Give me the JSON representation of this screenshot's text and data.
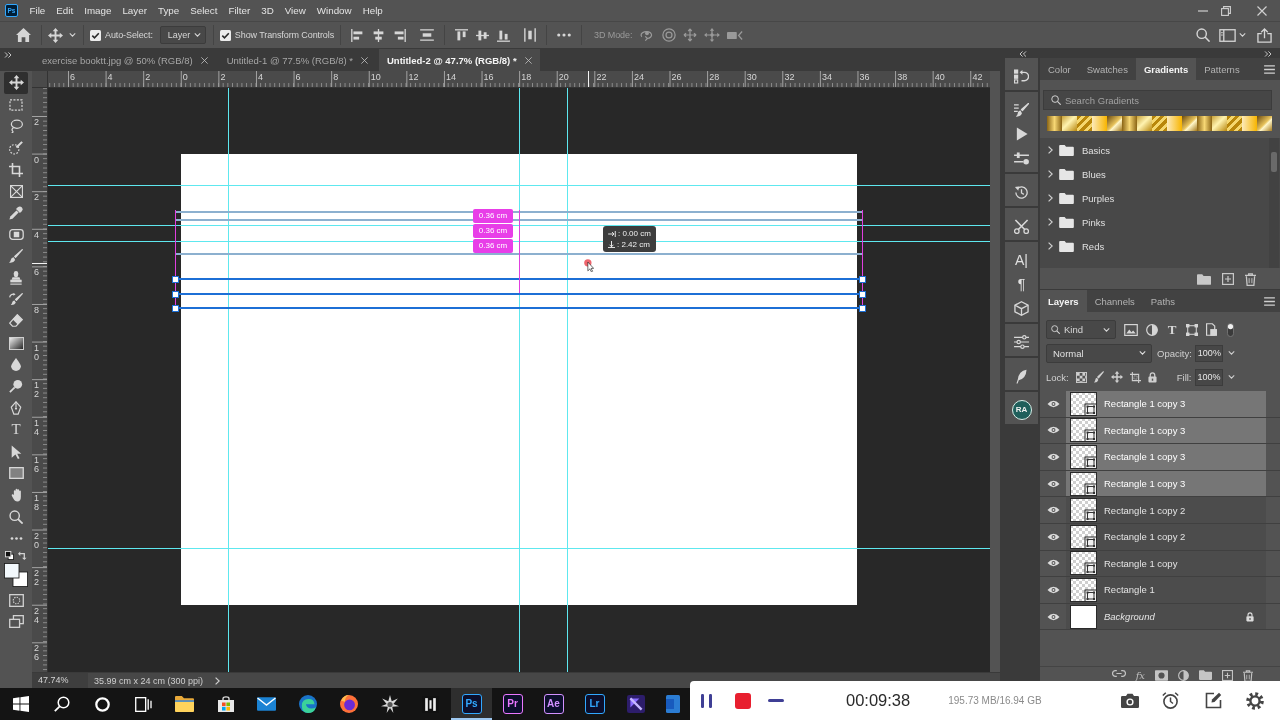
{
  "app_logo": "Ps",
  "menu": [
    "File",
    "Edit",
    "Image",
    "Layer",
    "Type",
    "Select",
    "Filter",
    "3D",
    "View",
    "Window",
    "Help"
  ],
  "options_bar": {
    "auto_select": {
      "label": "Auto-Select:",
      "checked": true
    },
    "auto_select_target": "Layer",
    "show_transform_controls": {
      "label": "Show Transform Controls",
      "checked": true
    },
    "mode_3d": {
      "label": "3D Mode:",
      "disabled": true
    }
  },
  "document_tabs": [
    {
      "title": "exercise booktt.jpg @ 50% (RGB/8)",
      "selected": false
    },
    {
      "title": "Untitled-1 @ 77.5% (RGB/8) *",
      "selected": false
    },
    {
      "title": "Untitled-2 @ 47.7% (RGB/8) *",
      "selected": true
    }
  ],
  "tools": [
    {
      "kind": "move",
      "selected": true
    },
    {
      "kind": "marquee",
      "selected": false
    },
    {
      "kind": "lasso",
      "selected": false
    },
    {
      "kind": "quick_select",
      "selected": false
    },
    {
      "kind": "crop",
      "selected": false
    },
    {
      "kind": "frame",
      "selected": false
    },
    {
      "kind": "eyedropper",
      "selected": false
    },
    {
      "kind": "healing",
      "selected": false
    },
    {
      "kind": "brush",
      "selected": false
    },
    {
      "kind": "stamp",
      "selected": false
    },
    {
      "kind": "history_brush",
      "selected": false
    },
    {
      "kind": "eraser",
      "selected": false
    },
    {
      "kind": "gradient",
      "selected": false
    },
    {
      "kind": "blur",
      "selected": false
    },
    {
      "kind": "dodge",
      "selected": false
    },
    {
      "kind": "pen",
      "selected": false
    },
    {
      "kind": "type",
      "glyph": "T",
      "selected": false
    },
    {
      "kind": "path_select",
      "selected": false
    },
    {
      "kind": "rectangle",
      "selected": false
    },
    {
      "kind": "hand",
      "selected": false
    },
    {
      "kind": "zoom",
      "selected": false
    },
    {
      "kind": "more",
      "selected": false
    }
  ],
  "rulers": {
    "horizontal": [
      "6",
      "4",
      "2",
      "0",
      "2",
      "4",
      "6",
      "8",
      "10",
      "12",
      "14",
      "16",
      "18",
      "20",
      "22",
      "24",
      "26",
      "28",
      "30",
      "32",
      "34",
      "36",
      "38",
      "40",
      "42"
    ],
    "vertical": [
      "2",
      "0",
      "2",
      "4",
      "6",
      "8",
      "10",
      "12",
      "14",
      "16",
      "18",
      "20",
      "22",
      "24",
      "26"
    ]
  },
  "canvas": {
    "spacing_labels": [
      "0.36 cm",
      "0.36 cm",
      "0.36 cm"
    ],
    "position_readout": {
      "horizontal": ": 0.00 cm",
      "vertical": ": 2.42 cm"
    }
  },
  "status_bar": {
    "zoom": "47.74%",
    "document_size": "35.99 cm x 24 cm (300 ppi)"
  },
  "panel_icon_groups": [
    {
      "icons": [
        {
          "kind": "history_states"
        }
      ]
    },
    {
      "icons": [
        {
          "kind": "brush_settings"
        },
        {
          "kind": "actions"
        },
        {
          "kind": "properties"
        }
      ]
    },
    {
      "icons": [
        {
          "kind": "history"
        }
      ]
    },
    {
      "icons": [
        {
          "kind": "tool_presets"
        }
      ]
    },
    {
      "icons": [
        {
          "kind": "character",
          "glyph": "A|"
        },
        {
          "kind": "paragraph",
          "glyph": "¶"
        },
        {
          "kind": "cube"
        }
      ]
    },
    {
      "icons": [
        {
          "kind": "adjustments"
        }
      ]
    },
    {
      "icons": [
        {
          "kind": "feather"
        }
      ]
    },
    {
      "icons": [
        {
          "kind": "plugin",
          "label": "RA"
        }
      ]
    }
  ],
  "gradients_panel": {
    "tabs": [
      {
        "label": "Color",
        "selected": false
      },
      {
        "label": "Swatches",
        "selected": false
      },
      {
        "label": "Gradients",
        "selected": true
      },
      {
        "label": "Patterns",
        "selected": false
      }
    ],
    "search": {
      "placeholder": "Search Gradients"
    },
    "folders": [
      {
        "name": "Basics",
        "expanded": false
      },
      {
        "name": "Blues",
        "expanded": false
      },
      {
        "name": "Purples",
        "expanded": false
      },
      {
        "name": "Pinks",
        "expanded": false
      },
      {
        "name": "Reds",
        "expanded": false
      }
    ]
  },
  "layers_panel": {
    "tabs": [
      {
        "label": "Layers",
        "selected": true
      },
      {
        "label": "Channels",
        "selected": false
      },
      {
        "label": "Paths",
        "selected": false
      }
    ],
    "filter": {
      "label": "Kind",
      "buttons": [
        {
          "kind": "pixel"
        },
        {
          "kind": "adjustment"
        },
        {
          "kind": "type",
          "glyph": "T"
        },
        {
          "kind": "shape"
        },
        {
          "kind": "smart_object"
        }
      ],
      "on": true
    },
    "blend_mode": "Normal",
    "opacity": {
      "label": "Opacity:",
      "value": "100%"
    },
    "lock_label": "Lock:",
    "fill": {
      "label": "Fill:",
      "value": "100%"
    },
    "layers": [
      {
        "name": "Rectangle 1 copy 3",
        "kind": "shape",
        "visible": true,
        "selected": true,
        "locked": false
      },
      {
        "name": "Rectangle 1 copy 3",
        "kind": "shape",
        "visible": true,
        "selected": true,
        "locked": false
      },
      {
        "name": "Rectangle 1 copy 3",
        "kind": "shape",
        "visible": true,
        "selected": true,
        "locked": false
      },
      {
        "name": "Rectangle 1 copy 3",
        "kind": "shape",
        "visible": true,
        "selected": true,
        "locked": false
      },
      {
        "name": "Rectangle 1 copy 2",
        "kind": "shape",
        "visible": true,
        "selected": false,
        "locked": false
      },
      {
        "name": "Rectangle 1 copy 2",
        "kind": "shape",
        "visible": true,
        "selected": false,
        "locked": false
      },
      {
        "name": "Rectangle 1 copy",
        "kind": "shape",
        "visible": true,
        "selected": false,
        "locked": false
      },
      {
        "name": "Rectangle 1",
        "kind": "shape",
        "visible": true,
        "selected": false,
        "locked": false
      },
      {
        "name": "Background",
        "kind": "background",
        "visible": true,
        "selected": false,
        "locked": true
      }
    ],
    "footer_buttons": [
      {
        "kind": "link"
      },
      {
        "kind": "effects",
        "glyph": "fx"
      },
      {
        "kind": "mask"
      },
      {
        "kind": "adjustment"
      },
      {
        "kind": "group"
      },
      {
        "kind": "new"
      },
      {
        "kind": "delete"
      }
    ]
  },
  "taskbar": {
    "apps": [
      {
        "kind": "start",
        "active": false
      },
      {
        "kind": "search",
        "active": false
      },
      {
        "kind": "cortana",
        "active": false
      },
      {
        "kind": "task_view",
        "active": false
      },
      {
        "kind": "file_explorer",
        "active": false
      },
      {
        "kind": "store",
        "active": false
      },
      {
        "kind": "mail",
        "active": false
      },
      {
        "kind": "edge",
        "active": false
      },
      {
        "kind": "firefox",
        "active": false
      },
      {
        "kind": "spark_app",
        "active": false
      },
      {
        "kind": "glyph_app",
        "active": false
      },
      {
        "kind": "tile",
        "label": "Ps",
        "color": "#31a8ff",
        "active": true
      },
      {
        "kind": "tile",
        "label": "Pr",
        "color": "#ea77ff",
        "active": false
      },
      {
        "kind": "tile",
        "label": "Ae",
        "color": "#d291ff",
        "active": false
      },
      {
        "kind": "tile",
        "label": "Lr",
        "color": "#31a8ff",
        "active": false
      },
      {
        "kind": "purple_app",
        "active": false
      },
      {
        "kind": "word",
        "active": false
      }
    ]
  },
  "recorder": {
    "elapsed": "00:09:38",
    "memory": "195.73 MB/16.94 GB"
  }
}
